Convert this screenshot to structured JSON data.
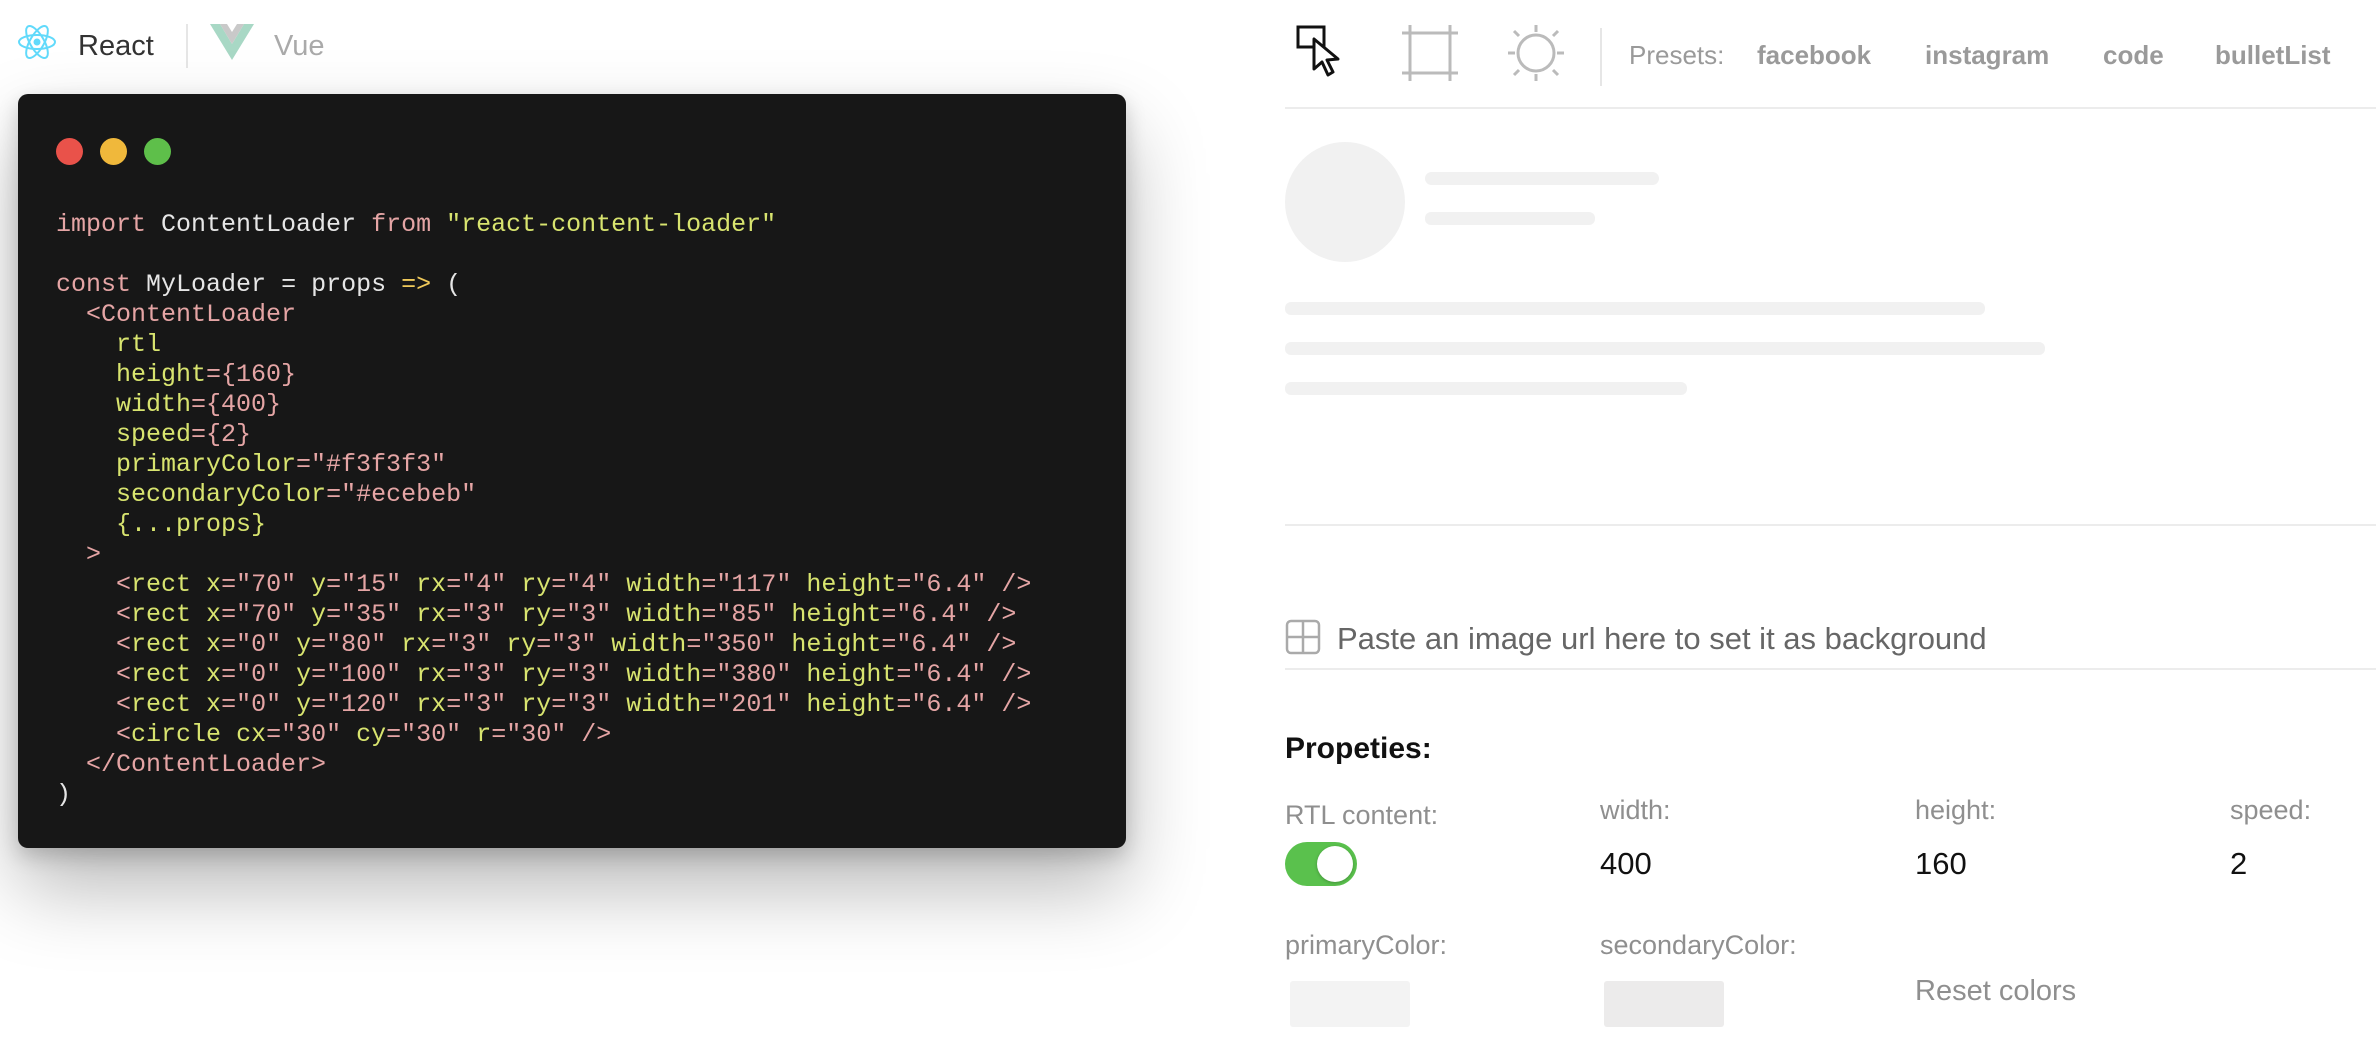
{
  "frameworks": {
    "react": "React",
    "vue": "Vue"
  },
  "code": {
    "line1": {
      "kw1": "import",
      "name": "ContentLoader",
      "kw2": "from",
      "str": "\"react-content-loader\""
    },
    "line3": {
      "kw": "const",
      "name": "MyLoader",
      "eq": "=",
      "props": "props",
      "arrow": "=>",
      "paren": "("
    },
    "open_tag": "<ContentLoader",
    "attrs": [
      {
        "name": "rtl",
        "value": ""
      },
      {
        "name": "height",
        "value": "={160}"
      },
      {
        "name": "width",
        "value": "={400}"
      },
      {
        "name": "speed",
        "value": "={2}"
      },
      {
        "name": "primaryColor",
        "value": "=\"#f3f3f3\""
      },
      {
        "name": "secondaryColor",
        "value": "=\"#ecebeb\""
      },
      {
        "name": "{...props}",
        "value": ""
      }
    ],
    "open_close": ">",
    "rects": [
      {
        "x": "\"70\"",
        "y": "\"15\"",
        "rx": "\"4\"",
        "ry": "\"4\"",
        "width": "\"117\"",
        "height": "\"6.4\""
      },
      {
        "x": "\"70\"",
        "y": "\"35\"",
        "rx": "\"3\"",
        "ry": "\"3\"",
        "width": "\"85\"",
        "height": "\"6.4\""
      },
      {
        "x": "\"0\"",
        "y": "\"80\"",
        "rx": "\"3\"",
        "ry": "\"3\"",
        "width": "\"350\"",
        "height": "\"6.4\""
      },
      {
        "x": "\"0\"",
        "y": "\"100\"",
        "rx": "\"3\"",
        "ry": "\"3\"",
        "width": "\"380\"",
        "height": "\"6.4\""
      },
      {
        "x": "\"0\"",
        "y": "\"120\"",
        "rx": "\"3\"",
        "ry": "\"3\"",
        "width": "\"201\"",
        "height": "\"6.4\""
      }
    ],
    "circle": {
      "cx": "\"30\"",
      "cy": "\"30\"",
      "r": "\"30\""
    },
    "close_tag": "</ContentLoader>",
    "close_paren": ")"
  },
  "toolbar": {
    "select_tool_icon": "cursor-icon",
    "rect_tool_icon": "rect-icon",
    "circle_tool_icon": "circle-icon",
    "presets_label": "Presets:",
    "presets": [
      "facebook",
      "instagram",
      "code",
      "bulletList"
    ]
  },
  "background": {
    "placeholder": "Paste an image url here to set it as background",
    "icon": "grid-icon"
  },
  "properties": {
    "title": "Propeties:",
    "rtl_label": "RTL content:",
    "rtl_enabled": true,
    "width_label": "width:",
    "width_value": "400",
    "height_label": "height:",
    "height_value": "160",
    "speed_label": "speed:",
    "speed_value": "2",
    "primary_label": "primaryColor:",
    "primary_color": "#f3f3f3",
    "secondary_label": "secondaryColor:",
    "secondary_color": "#ecebeb",
    "reset_label": "Reset colors"
  },
  "colors": {
    "toggle_on": "#5ac14d",
    "editor_bg": "#171717",
    "skeleton": "#f1f1f1"
  }
}
